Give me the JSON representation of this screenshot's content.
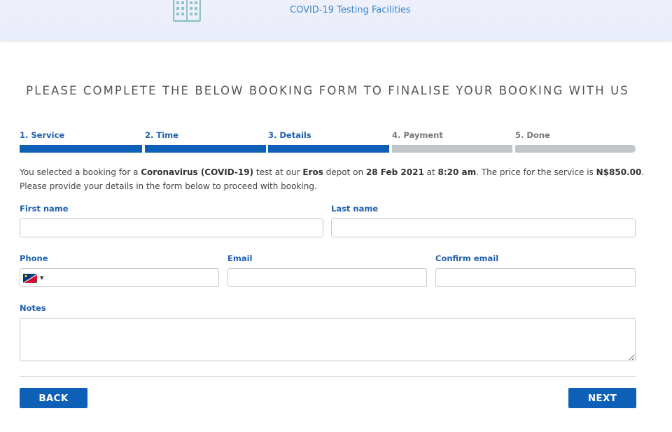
{
  "header": {
    "site_title": "COVID-19 Testing Facilities",
    "logo_icon": "building-icon",
    "logo_color": "#8fc3c2"
  },
  "page": {
    "heading": "PLEASE COMPLETE THE BELOW BOOKING FORM TO FINALISE YOUR BOOKING WITH US"
  },
  "steps": [
    {
      "label": "1. Service",
      "state": "done"
    },
    {
      "label": "2. Time",
      "state": "done"
    },
    {
      "label": "3. Details",
      "state": "done"
    },
    {
      "label": "4. Payment",
      "state": "todo"
    },
    {
      "label": "5. Done",
      "state": "todo"
    }
  ],
  "info": {
    "p1": "You selected a booking for a ",
    "service": "Coronavirus (COVID-19)",
    "p2": " test at our ",
    "depot": "Eros",
    "p3": " depot on ",
    "date": "28 Feb 2021",
    "p4": " at ",
    "time": "8:20 am",
    "p5": ". The price for the service is ",
    "price": "N$850.00",
    "p6": ".",
    "line2": "Please provide your details in the form below to proceed with booking."
  },
  "form": {
    "first_name_label": "First name",
    "first_name_value": "",
    "last_name_label": "Last name",
    "last_name_value": "",
    "phone_label": "Phone",
    "phone_value": "",
    "phone_country_icon": "namibia-flag-icon",
    "email_label": "Email",
    "email_value": "",
    "confirm_email_label": "Confirm email",
    "confirm_email_value": "",
    "notes_label": "Notes",
    "notes_value": ""
  },
  "buttons": {
    "back": "BACK",
    "next": "NEXT"
  },
  "colors": {
    "primary": "#0d5fb8",
    "label_blue": "#1e5fb0",
    "inactive_step": "#c1c5c8",
    "title_blue": "#3a86c8"
  }
}
